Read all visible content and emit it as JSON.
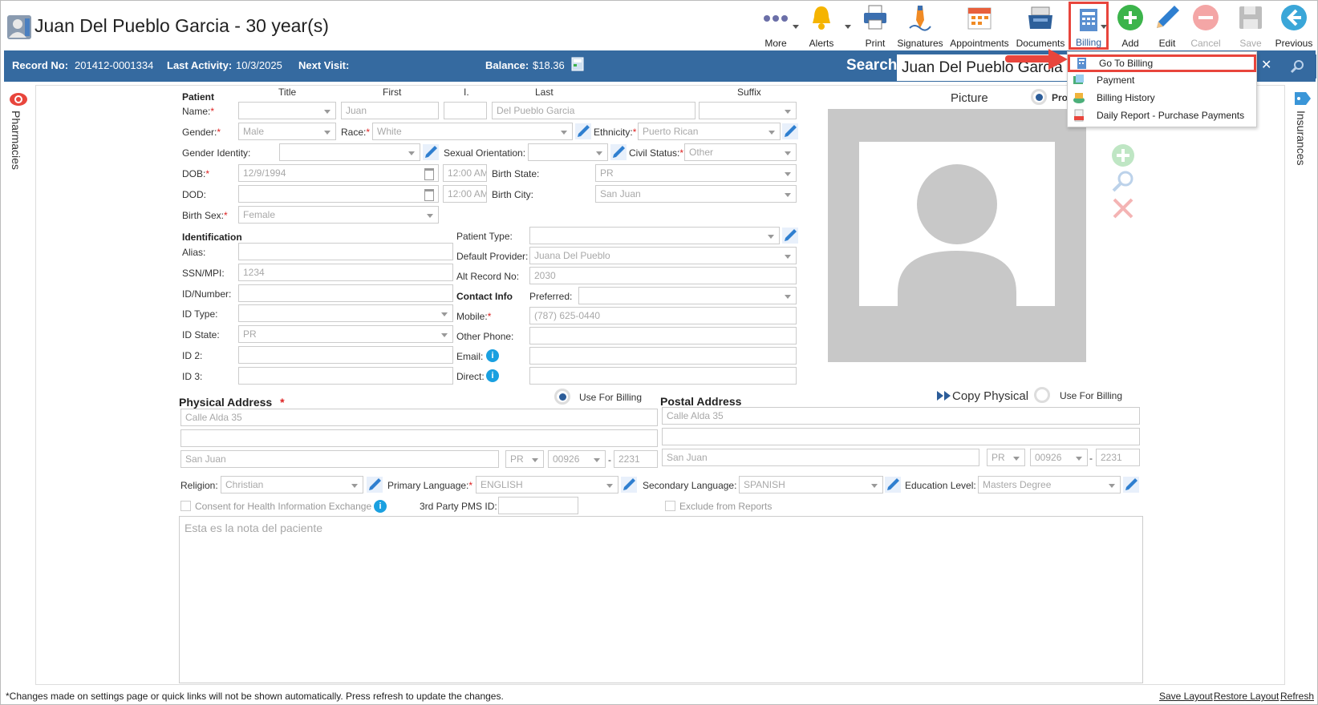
{
  "header": {
    "patient_title": "Juan Del Pueblo Garcia - 30 year(s)",
    "toolbar": {
      "more": "More",
      "alerts": "Alerts",
      "print": "Print",
      "signatures": "Signatures",
      "appointments": "Appointments",
      "documents": "Documents",
      "billing": "Billing",
      "add": "Add",
      "edit": "Edit",
      "cancel": "Cancel",
      "save": "Save",
      "previous": "Previous"
    }
  },
  "info_bar": {
    "record_label": "Record No:",
    "record_value": "201412-0001334",
    "last_activity_label": "Last Activity:",
    "last_activity_value": "10/3/2025",
    "next_visit_label": "Next Visit:",
    "balance_label": "Balance:",
    "balance_value": "$18.36",
    "search_label": "Search:",
    "search_value": "Juan Del Pueblo Garcia"
  },
  "billing_menu": {
    "items": [
      "Go To Billing",
      "Payment",
      "Billing History",
      "Daily Report - Purchase Payments"
    ],
    "highlighted": "Go To Billing"
  },
  "side_tabs": {
    "left": "Pharmacies",
    "right": "Insurances"
  },
  "form": {
    "patient_header": "Patient",
    "col_title": "Title",
    "col_first": "First",
    "col_middle": "I.",
    "col_last": "Last",
    "col_suffix": "Suffix",
    "name_label": "Name:",
    "first_name": "Juan",
    "middle": "",
    "last_name": "Del Pueblo Garcia",
    "gender_label": "Gender:",
    "gender": "Male",
    "race_label": "Race:",
    "race": "White",
    "ethnicity_label": "Ethnicity:",
    "ethnicity": "Puerto Rican",
    "gender_identity_label": "Gender Identity:",
    "gender_identity": "",
    "sexual_orientation_label": "Sexual Orientation:",
    "sexual_orientation": "",
    "civil_status_label": "Civil Status:",
    "civil_status": "Other",
    "dob_label": "DOB:",
    "dob": "12/9/1994",
    "dob_time": "12:00 AM",
    "birth_state_label": "Birth State:",
    "birth_state": "PR",
    "dod_label": "DOD:",
    "dod": "",
    "dod_time": "12:00 AM",
    "birth_city_label": "Birth City:",
    "birth_city": "San Juan",
    "birth_sex_label": "Birth Sex:",
    "birth_sex": "Female",
    "identification_header": "Identification",
    "alias_label": "Alias:",
    "alias": "",
    "ssn_label": "SSN/MPI:",
    "ssn": "1234",
    "id_number_label": "ID/Number:",
    "id_type_label": "ID Type:",
    "id_state_label": "ID State:",
    "id_state": "PR",
    "id2_label": "ID 2:",
    "id3_label": "ID 3:",
    "patient_type_label": "Patient Type:",
    "patient_type": "",
    "default_provider_label": "Default Provider:",
    "default_provider": "Juana Del Pueblo",
    "alt_record_label": "Alt Record No:",
    "alt_record": "2030",
    "contact_header": "Contact Info",
    "preferred_label": "Preferred:",
    "mobile_label": "Mobile:",
    "mobile": "(787) 625-0440",
    "other_phone_label": "Other Phone:",
    "email_label": "Email:",
    "direct_label": "Direct:",
    "picture_label": "Picture",
    "picture_radio_label": "Pro",
    "physical_header": "Physical Address",
    "physical_use_billing": "Use For Billing",
    "physical_line1": "Calle Alda 35",
    "physical_line2": "",
    "physical_city": "San Juan",
    "physical_state": "PR",
    "physical_zip": "00926",
    "physical_zip4": "2231",
    "postal_header": "Postal Address",
    "copy_physical": "Copy Physical",
    "postal_use_billing": "Use For Billing",
    "postal_line1": "Calle Alda 35",
    "postal_line2": "",
    "postal_city": "San Juan",
    "postal_state": "PR",
    "postal_zip": "00926",
    "postal_zip4": "2231",
    "religion_label": "Religion:",
    "religion": "Christian",
    "primary_language_label": "Primary Language:",
    "primary_language": "ENGLISH",
    "secondary_language_label": "Secondary Language:",
    "secondary_language": "SPANISH",
    "education_label": "Education Level:",
    "education": "Masters Degree",
    "consent_label": "Consent for Health Information Exchange",
    "third_party_label": "3rd Party PMS ID:",
    "exclude_label": "Exclude from Reports",
    "notes": "Esta es la nota del paciente"
  },
  "footer": {
    "note": "*Changes made on settings page or quick links will not be shown automatically. Press refresh to update the changes.",
    "save_layout": "Save Layout",
    "restore_layout": "Restore Layout",
    "refresh": "Refresh"
  },
  "colors": {
    "accent": "#356aa0",
    "highlight": "#e8453c"
  }
}
